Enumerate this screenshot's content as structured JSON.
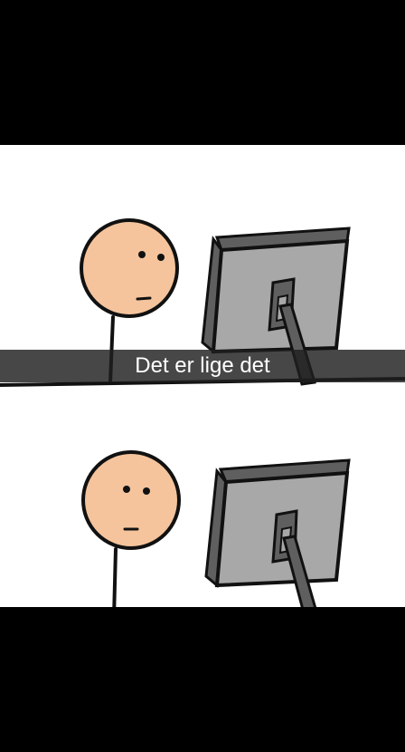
{
  "caption": {
    "text": "Det er lige det"
  },
  "colors": {
    "letterbox": "#000000",
    "comic_background": "#ffffff",
    "skin": "#f5c49c",
    "monitor_gray": "#a8a8a8",
    "monitor_dark": "#5f5f5f",
    "outline": "#111111",
    "caption_bar": "rgba(30,30,30,0.82)",
    "caption_text": "#ffffff"
  },
  "panels": [
    {
      "name": "top-panel",
      "figure": "stick-figure-looking-at-monitor"
    },
    {
      "name": "bottom-panel",
      "figure": "stick-figure-looking-at-monitor"
    }
  ]
}
